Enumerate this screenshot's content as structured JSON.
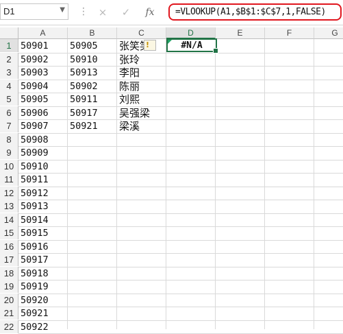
{
  "name_box": {
    "value": "D1"
  },
  "formula_bar": {
    "cancel_icon": "×",
    "enter_icon": "✓",
    "fx_label": "fx",
    "formula": "=VLOOKUP(A1,$B$1:$C$7,1,FALSE)"
  },
  "columns": [
    "A",
    "B",
    "C",
    "D",
    "E",
    "F",
    "G"
  ],
  "rows": [
    "1",
    "2",
    "3",
    "4",
    "5",
    "6",
    "7",
    "8",
    "9",
    "10",
    "11",
    "12",
    "13",
    "14",
    "15",
    "16",
    "17",
    "18",
    "19",
    "20",
    "21",
    "22"
  ],
  "cells": {
    "A": [
      "50901",
      "50902",
      "50903",
      "50904",
      "50905",
      "50906",
      "50907",
      "50908",
      "50909",
      "50910",
      "50911",
      "50912",
      "50913",
      "50914",
      "50915",
      "50916",
      "50917",
      "50918",
      "50919",
      "50920",
      "50921",
      "50922"
    ],
    "B": [
      "50905",
      "50910",
      "50913",
      "50902",
      "50911",
      "50917",
      "50921"
    ],
    "C": [
      "张笑笑",
      "张玲",
      "李阳",
      "陈丽",
      "刘熙",
      "吴强梁",
      "梁溪"
    ],
    "D1": "#N/A"
  },
  "error_indicator": {
    "icon": "!"
  }
}
